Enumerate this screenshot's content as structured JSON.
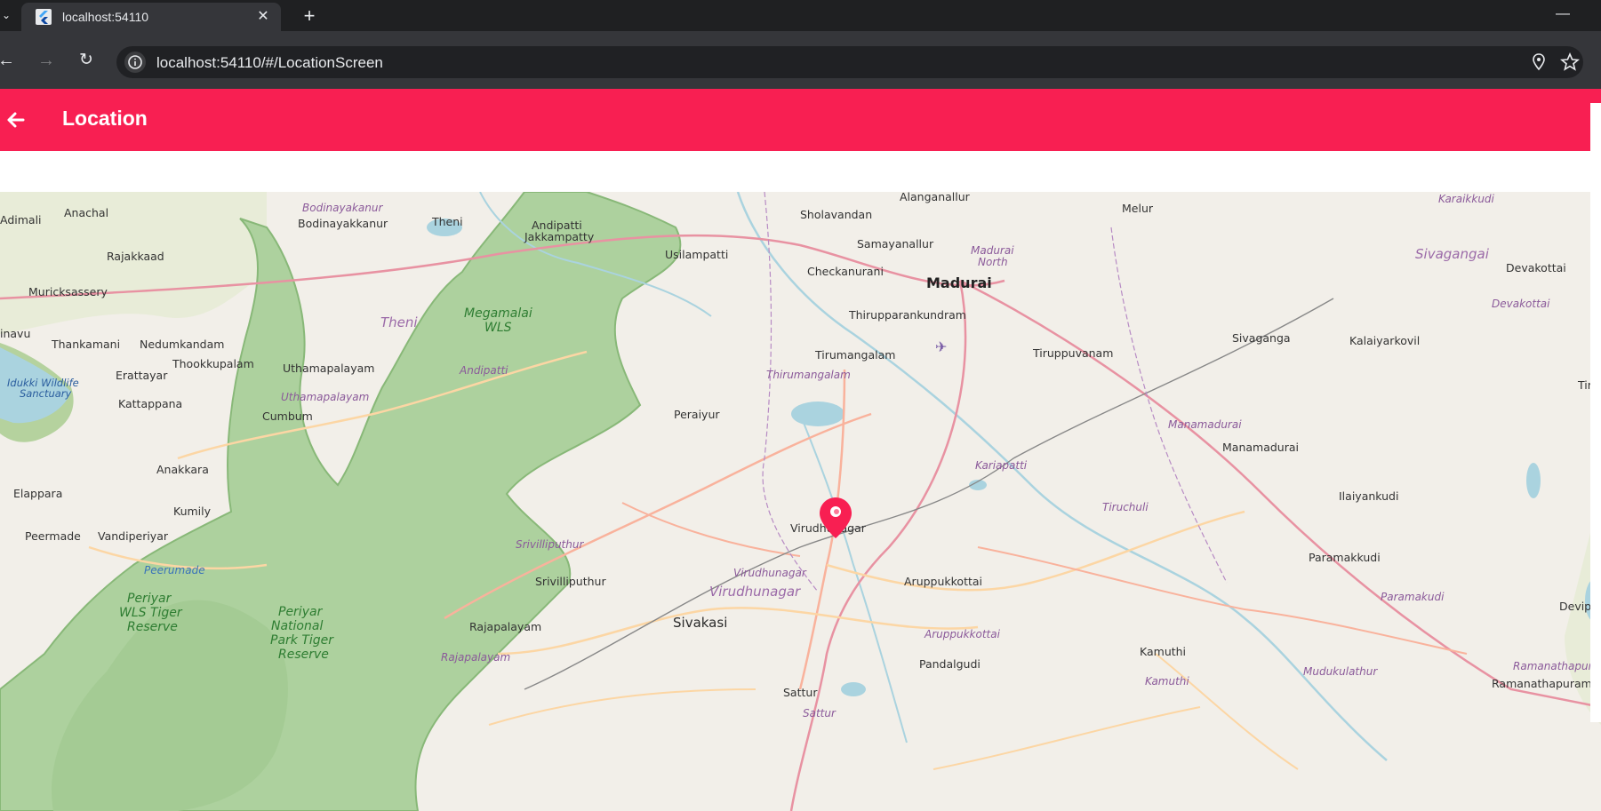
{
  "browser": {
    "tab_title": "localhost:54110",
    "url": "localhost:54110/#/LocationScreen",
    "icons": [
      "tab-dropdown-icon",
      "flutter-favicon",
      "close-icon",
      "plus-icon",
      "minimize-icon",
      "back-arrow-icon",
      "forward-arrow-icon",
      "reload-icon",
      "site-info-icon",
      "location-pin-icon",
      "star-icon"
    ]
  },
  "app": {
    "title": "Location",
    "accent_color": "#f81f52"
  },
  "map": {
    "marker_color": "#f81f52",
    "places": [
      "Alanganallur",
      "Melur",
      "Karaikkudi",
      "Adimali",
      "Anachal",
      "Bodinayakanur",
      "Bodinayakkanur",
      "Theni",
      "Andipatti",
      "Jakkampatty",
      "Sholavandan",
      "Samayanallur",
      "Madurai North",
      "Usilampatti",
      "Checkanurani",
      "Madurai",
      "Sivagangai",
      "Devakottai",
      "Rajakkaad",
      "Muricksassery",
      "Thirupparankundram",
      "Megamalai WLS",
      "Theni",
      "Devakottai",
      "Thankamani",
      "Nedumkandam",
      "Sivaganga",
      "Kalaiyarkovil",
      "Tiruv",
      "Tirumangalam",
      "Tiruppuvanam",
      "Idukki Wildlife Sanctuary",
      "Thookkupalam",
      "Uthamapalayam",
      "Andipatti",
      "Erattayar",
      "Thirumangalam",
      "Uthamapalayam",
      "Kattappana",
      "Cumbum",
      "Peraiyur",
      "Manamadurai",
      "Manamadurai",
      "Kariapatti",
      "Anakkara",
      "Elappara",
      "Kumily",
      "Tiruchuli",
      "Ilaiyankudi",
      "Virudhunagar",
      "Peermade",
      "Vandiperiyar",
      "Srivilliputhur",
      "Paramakkudi",
      "Peerumade",
      "Srivilliputhur",
      "Virudhunagar",
      "Virudhunagar",
      "Aruppukkottai",
      "Paramakudi",
      "Devipatti",
      "Periyar WLS Tiger Reserve",
      "Periyar National Park Tiger Reserve",
      "Sivakasi",
      "Rajapalayam",
      "Aruppukkottai",
      "Rajapalayam",
      "Pandalgudi",
      "Kamuthi",
      "Mudukulathur",
      "Ramanathapuram",
      "Ramanathapuram",
      "Kamuthi",
      "Sattur",
      "Sattur"
    ]
  }
}
